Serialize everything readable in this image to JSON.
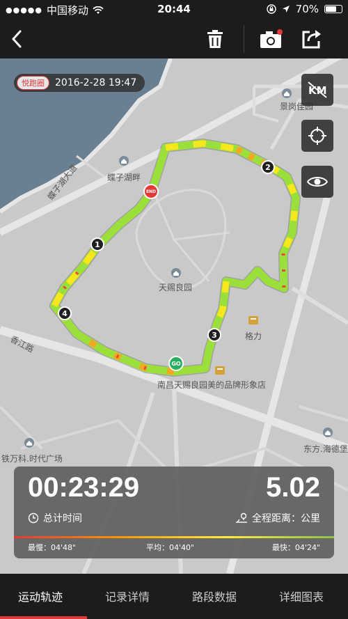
{
  "status_bar": {
    "carrier": "中国移动",
    "time": "20:44",
    "battery": "70%",
    "battery_level": 0.7
  },
  "nav": {
    "back_icon": "chevron-left-icon",
    "delete_icon": "trash-icon",
    "camera_icon": "camera-icon",
    "share_icon": "share-icon",
    "camera_dot_color": "#e53935"
  },
  "badge": {
    "brand": "悦跑圈",
    "datetime": "2016-2-28 19:47"
  },
  "map_labels": {
    "jinggang": "景岗佳园",
    "dieziLake": "蝶子湖畔",
    "dieziRoad": "蝶子湖大道",
    "tianci": "天赐良园",
    "geli": "格力",
    "xiangjiang": "香江路",
    "store": "南昌天赐良园美的品牌形象店",
    "tiewanke": "铁万科.时代广场",
    "dongfang": "东方.海德堡"
  },
  "markers": {
    "end": "END",
    "go": "GO",
    "km1": "1",
    "km2": "2",
    "km3": "3",
    "km4": "4"
  },
  "stats": {
    "total_time": "00:23:29",
    "total_time_label": "总计时间",
    "distance": "5.02",
    "distance_label": "全程距离：公里",
    "slowest": "最慢：04'48\"",
    "average": "平均：04'40\"",
    "fastest": "最快：04'24\""
  },
  "tabs": [
    "运动轨迹",
    "记录详情",
    "路段数据",
    "详细图表"
  ],
  "colors": {
    "accent": "#e53935",
    "route_green": "#7ed321",
    "route_yellow": "#f8e71c",
    "route_orange": "#f5a623"
  }
}
